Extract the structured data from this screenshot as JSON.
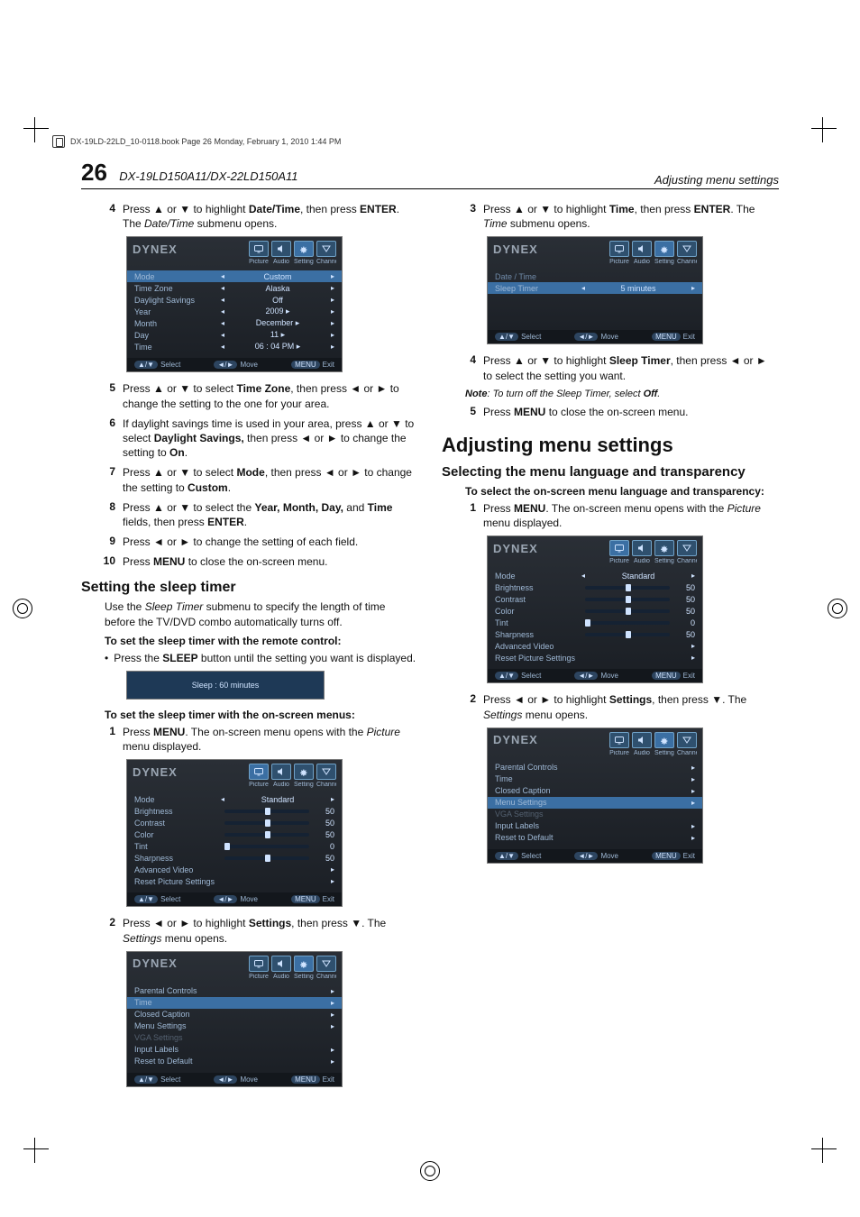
{
  "bookline": "DX-19LD-22LD_10-0118.book  Page 26  Monday, February 1, 2010  1:44 PM",
  "header": {
    "page_number": "26",
    "model": "DX-19LD150A11/DX-22LD150A11",
    "section_right": "Adjusting menu settings"
  },
  "arrows": {
    "up": "▲",
    "down": "▼",
    "left": "◄",
    "right": "►"
  },
  "osd_common": {
    "brand": "DYNEX",
    "tab_labels": [
      "Picture",
      "Audio",
      "Settings",
      "Channel"
    ],
    "foot_select": "Select",
    "foot_move": "Move",
    "foot_exit": "Exit",
    "foot_key_sel": "▲/▼",
    "foot_key_move": "◄/►",
    "foot_key_exit": "MENU"
  },
  "left": {
    "step4": {
      "n": "4",
      "t1": "Press ",
      "t2": " or ",
      "t3": " to highlight ",
      "kw": "Date/Time",
      "t4": ", then press ",
      "kw2": "ENTER",
      "t5": ". The ",
      "it": "Date/Time",
      "t6": " submenu opens."
    },
    "osd_datetime": {
      "rows": [
        {
          "lab": "Mode",
          "val": "Custom",
          "hl": true
        },
        {
          "lab": "Time Zone",
          "val": "Alaska"
        },
        {
          "lab": "Daylight Savings",
          "val": "Off"
        },
        {
          "lab": "Year",
          "val": "2009 ▸"
        },
        {
          "lab": "Month",
          "val": "December ▸"
        },
        {
          "lab": "Day",
          "val": "11 ▸"
        },
        {
          "lab": "Time",
          "val": "06 : 04   PM ▸"
        }
      ]
    },
    "step5": {
      "n": "5",
      "t": "Press ▲ or ▼ to select ",
      "kw": "Time Zone",
      "t2": ", then press ◄ or ► to change the setting to the one for your area."
    },
    "step6": {
      "n": "6",
      "t": "If daylight savings time is used in your area, press ▲ or ▼ to select ",
      "kw": "Daylight Savings,",
      "t2": " then press ◄ or ► to change the setting to ",
      "kw2": "On",
      "t3": "."
    },
    "step7": {
      "n": "7",
      "t": "Press ▲ or ▼ to select ",
      "kw": "Mode",
      "t2": ", then press ◄ or ► to change the setting to ",
      "kw2": "Custom",
      "t3": "."
    },
    "step8": {
      "n": "8",
      "t": "Press ▲ or ▼ to select the ",
      "kw": "Year, Month, Day,",
      "t2": " and ",
      "kw2": "Time",
      "t3": " fields, then press ",
      "kw3": "ENTER",
      "t4": "."
    },
    "step9": {
      "n": "9",
      "t": "Press ◄ or ► to change the setting of each field."
    },
    "step10": {
      "n": "10",
      "t": "Press ",
      "kw": "MENU",
      "t2": " to close the on-screen menu."
    },
    "h_sleep": "Setting the sleep timer",
    "sleep_intro": "Use the Sleep Timer submenu to specify the length of time before the TV/DVD combo automatically turns off.",
    "sleep_intro_italic": "Sleep Timer",
    "lead1": "To set the sleep timer with the remote control:",
    "bullet1_a": "Press the ",
    "bullet1_kw": "SLEEP",
    "bullet1_b": " button until the setting you want is displayed.",
    "sleep_banner": "Sleep : 60 minutes",
    "lead2": "To set the sleep timer with the on-screen menus:",
    "sleep_s1": {
      "n": "1",
      "t": "Press ",
      "kw": "MENU",
      "t2": ". The on-screen menu opens with the ",
      "it": "Picture",
      "t3": " menu displayed."
    },
    "osd_picture": {
      "rows": [
        {
          "lab": "Mode",
          "val": "Standard"
        },
        {
          "lab": "Brightness",
          "slider": "s50",
          "num": "50"
        },
        {
          "lab": "Contrast",
          "slider": "s50",
          "num": "50"
        },
        {
          "lab": "Color",
          "slider": "s50",
          "num": "50"
        },
        {
          "lab": "Tint",
          "slider": "s0",
          "num": "0"
        },
        {
          "lab": "Sharpness",
          "slider": "s50",
          "num": "50"
        },
        {
          "lab": "Advanced Video",
          "arrow": true
        },
        {
          "lab": "Reset Picture Settings",
          "arrow": true
        }
      ]
    },
    "sleep_s2": {
      "n": "2",
      "t": "Press ◄ or ► to highlight ",
      "kw": "Settings",
      "t2": ", then press ▼. The ",
      "it": "Settings",
      "t3": " menu opens."
    },
    "osd_settings": {
      "rows": [
        {
          "lab": "Parental Controls",
          "arrow": true
        },
        {
          "lab": "Time",
          "arrow": true,
          "hl": true
        },
        {
          "lab": "Closed Caption",
          "arrow": true
        },
        {
          "lab": "Menu Settings",
          "arrow": true
        },
        {
          "lab": "VGA Settings",
          "dim": true
        },
        {
          "lab": "Input Labels",
          "arrow": true
        },
        {
          "lab": "Reset to Default",
          "arrow": true
        }
      ]
    }
  },
  "right": {
    "step3": {
      "n": "3",
      "t": "Press ▲ or ▼ to highlight ",
      "kw": "Time",
      "t2": ", then press ",
      "kw2": "ENTER",
      "t3": ". The ",
      "it": "Time",
      "t4": " submenu opens."
    },
    "osd_time": {
      "crumb": "Date / Time",
      "rows": [
        {
          "lab": "Sleep Timer",
          "val": "5 minutes",
          "hl": true
        }
      ]
    },
    "step4": {
      "n": "4",
      "t": "Press ▲ or ▼ to highlight ",
      "kw": "Sleep Timer",
      "t2": ", then press ◄ or ► to select the setting you want."
    },
    "note": {
      "a": "Note",
      "b": ": To turn off the Sleep Timer, select ",
      "c": "Off",
      "d": "."
    },
    "step5": {
      "n": "5",
      "t": "Press ",
      "kw": "MENU",
      "t2": " to close the on-screen menu."
    },
    "h_big": "Adjusting menu settings",
    "h_sub": "Selecting the menu language and transparency",
    "lead": "To select the on-screen menu language and transparency:",
    "s1": {
      "n": "1",
      "t": "Press ",
      "kw": "MENU",
      "t2": ". The on-screen menu opens with the ",
      "it": "Picture",
      "t3": " menu displayed."
    },
    "s2": {
      "n": "2",
      "t": "Press ◄ or ► to highlight ",
      "kw": "Settings",
      "t2": ", then press ▼. The ",
      "it": "Settings",
      "t3": " menu opens."
    },
    "osd_settings2": {
      "rows": [
        {
          "lab": "Parental Controls",
          "arrow": true
        },
        {
          "lab": "Time",
          "arrow": true
        },
        {
          "lab": "Closed Caption",
          "arrow": true
        },
        {
          "lab": "Menu Settings",
          "arrow": true,
          "hl": true
        },
        {
          "lab": "VGA Settings",
          "dim": true
        },
        {
          "lab": "Input Labels",
          "arrow": true
        },
        {
          "lab": "Reset to Default",
          "arrow": true
        }
      ]
    }
  }
}
